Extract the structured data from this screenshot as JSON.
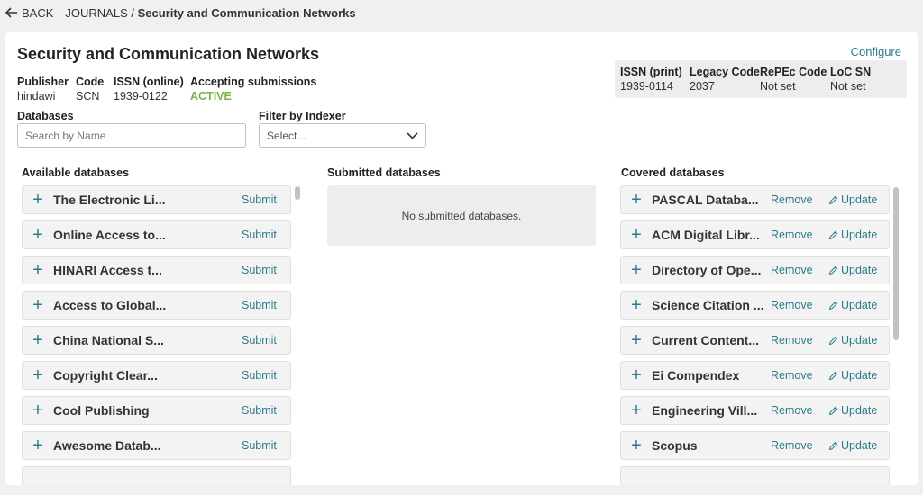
{
  "nav": {
    "back_label": "BACK",
    "breadcrumb_parent": "JOURNALS",
    "breadcrumb_sep": "/",
    "breadcrumb_current": "Security and Communication Networks"
  },
  "journal": {
    "title": "Security and Communication Networks",
    "configure_label": "Configure",
    "fields": [
      {
        "label": "Publisher",
        "value": "hindawi"
      },
      {
        "label": "Code",
        "value": "SCN"
      },
      {
        "label": "ISSN (online)",
        "value": "1939-0122"
      },
      {
        "label": "Accepting submissions",
        "value": "ACTIVE"
      }
    ],
    "extra_fields": [
      {
        "label": "ISSN (print)",
        "value": "1939-0114"
      },
      {
        "label": "Legacy Code",
        "value": "2037"
      },
      {
        "label": "RePEc Code",
        "value": "Not set"
      },
      {
        "label": "LoC SN",
        "value": "Not set"
      }
    ],
    "status_color": "#7cb342"
  },
  "filters": {
    "databases_label": "Databases",
    "search_placeholder": "Search by Name",
    "indexer_label": "Filter by Indexer",
    "indexer_value": "Select..."
  },
  "available": {
    "heading": "Available databases",
    "action_label": "Submit",
    "items": [
      "The Electronic Li...",
      "Online Access to...",
      "HINARI Access t...",
      "Access to Global...",
      "China National S...",
      "Copyright Clear...",
      "Cool Publishing",
      "Awesome Datab..."
    ]
  },
  "submitted": {
    "heading": "Submitted databases",
    "empty_text": "No submitted databases."
  },
  "covered": {
    "heading": "Covered databases",
    "remove_label": "Remove",
    "update_label": "Update",
    "items": [
      "PASCAL Databa...",
      "ACM Digital Libr...",
      "Directory of Ope...",
      "Science Citation ...",
      "Current Content...",
      "Ei Compendex",
      "Engineering Vill...",
      "Scopus"
    ]
  },
  "colors": {
    "accent": "#2d7a8e",
    "active": "#7cb342",
    "background": "#f0f0f0",
    "row_background": "#f3f3f3"
  },
  "icons": {
    "back": "arrow-left-icon",
    "add": "plus-icon",
    "dropdown": "chevron-down-icon",
    "update": "pencil-icon"
  }
}
